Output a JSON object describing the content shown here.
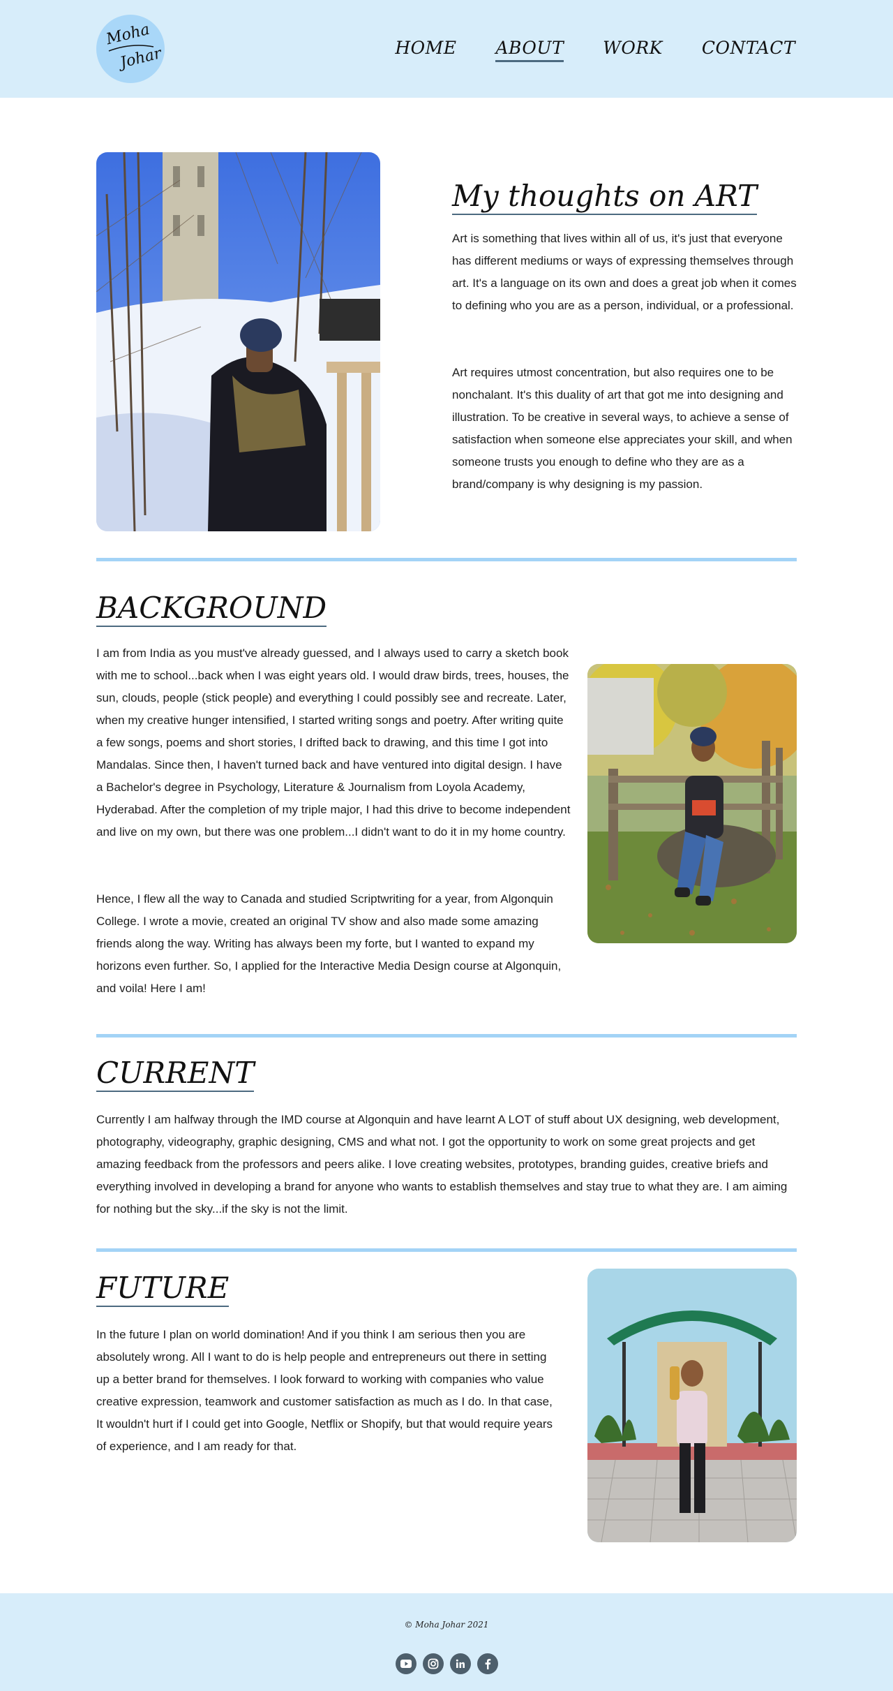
{
  "header": {
    "logo": {
      "line1": "Moha",
      "line2": "Johar"
    },
    "nav": [
      {
        "label": "HOME"
      },
      {
        "label": "ABOUT"
      },
      {
        "label": "WORK"
      },
      {
        "label": "CONTACT"
      }
    ],
    "active_nav": "ABOUT"
  },
  "art": {
    "heading": "My thoughts on ART",
    "paragraphs": [
      "Art is something that lives within all of us, it's just that everyone has different mediums or ways of expressing themselves through art. It's a language on its own and does a great job when it comes to defining who you are as a person, individual, or a professional.",
      "Art requires utmost concentration, but also requires one to be nonchalant. It's this duality of art that got me into designing and illustration. To be creative in several ways, to achieve a sense of satisfaction when someone else appreciates your skill, and when someone trusts you enough to define who they are as a brand/company is why designing is my passion."
    ]
  },
  "background": {
    "heading": "BACKGROUND",
    "paragraphs": [
      "I am from India as you must've already guessed, and I always used to carry a sketch book with me to school...back when I was eight years old. I would draw birds, trees, houses, the sun, clouds, people (stick people) and everything I could possibly see and recreate. Later, when my creative hunger intensified, I started writing songs and poetry. After writing quite a few songs, poems and short stories, I drifted back to drawing, and this time I got into Mandalas. Since then, I haven't turned back and have ventured into digital design. I have a Bachelor's degree in Psychology, Literature & Journalism from Loyola Academy, Hyderabad. After the completion of my triple major, I had this drive to become independent and live on my own, but there was one problem...I didn't want to do it in my home country.",
      "Hence, I flew all the way to Canada and studied Scriptwriting for a year, from Algonquin College. I wrote a movie, created an original TV show and also made some amazing friends along the way. Writing has always been my forte, but I wanted to expand my horizons even further. So, I applied for the Interactive Media Design course at Algonquin, and voila! Here I am!"
    ]
  },
  "current": {
    "heading": "CURRENT",
    "paragraph": "Currently I am halfway through the IMD course at Algonquin and have learnt A LOT of stuff about UX designing, web development, photography, videography, graphic designing, CMS and what not. I got the opportunity to work on some great projects and get amazing feedback from the professors and peers alike. I love creating websites, prototypes, branding guides, creative briefs and everything involved in developing a brand for anyone who wants to establish themselves and stay true to what they are. I am aiming for nothing but the sky...if the sky is not the limit."
  },
  "future": {
    "heading": "FUTURE",
    "paragraph": "In the future I plan on world domination! And if you think I am serious then you are absolutely wrong. All I want to do is help people and entrepreneurs out there in setting up a better brand for themselves. I look forward to working with companies who value creative expression, teamwork and customer satisfaction as much as I do. In that case, It wouldn't hurt if I could get into Google, Netflix or Shopify,  but that would require years of experience, and I am ready for that."
  },
  "footer": {
    "copyright": "© Moha Johar 2021",
    "socials": [
      {
        "icon": "youtube-icon"
      },
      {
        "icon": "instagram-icon"
      },
      {
        "icon": "linkedin-icon"
      },
      {
        "icon": "facebook-icon"
      }
    ]
  },
  "colors": {
    "header_bg": "#d7edfa",
    "logo_bg": "#a9d7f8",
    "divider": "#a3d3f6",
    "underline": "#4c6a80",
    "social_icon_bg": "#4d5f6c"
  }
}
